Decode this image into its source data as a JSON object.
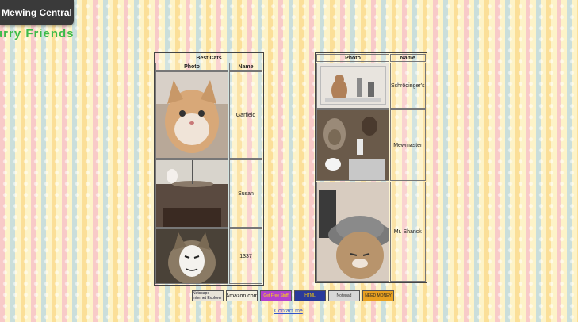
{
  "site": {
    "title": "Mewing Central"
  },
  "page": {
    "heading": "urry Friends"
  },
  "left_table": {
    "caption": "Best Cats",
    "headers": {
      "photo": "Photo",
      "name": "Name"
    },
    "rows": [
      {
        "name": "Garfield"
      },
      {
        "name": "Susan"
      },
      {
        "name": "1337"
      }
    ]
  },
  "right_table": {
    "headers": {
      "photo": "Photo",
      "name": "Name"
    },
    "rows": [
      {
        "name": "Schrödinger's"
      },
      {
        "name": "Mewmaster"
      },
      {
        "name": "Mr. Shanck"
      }
    ]
  },
  "badges": [
    {
      "label": "Netscape Internet Explorer",
      "bg": "#e8e4d8",
      "fg": "#223"
    },
    {
      "label": "Amazon.com",
      "bg": "#f4f0e0",
      "fg": "#111"
    },
    {
      "label": "Get Free Stuff",
      "bg": "#b040d0",
      "fg": "#ffe300"
    },
    {
      "label": "HTML",
      "bg": "#2a3a9a",
      "fg": "#ffd000"
    },
    {
      "label": "Notepad",
      "bg": "#d8d8d8",
      "fg": "#333"
    },
    {
      "label": "NEED MONEY",
      "bg": "#e8a020",
      "fg": "#222"
    }
  ],
  "footer": {
    "contact": "Contact me"
  }
}
